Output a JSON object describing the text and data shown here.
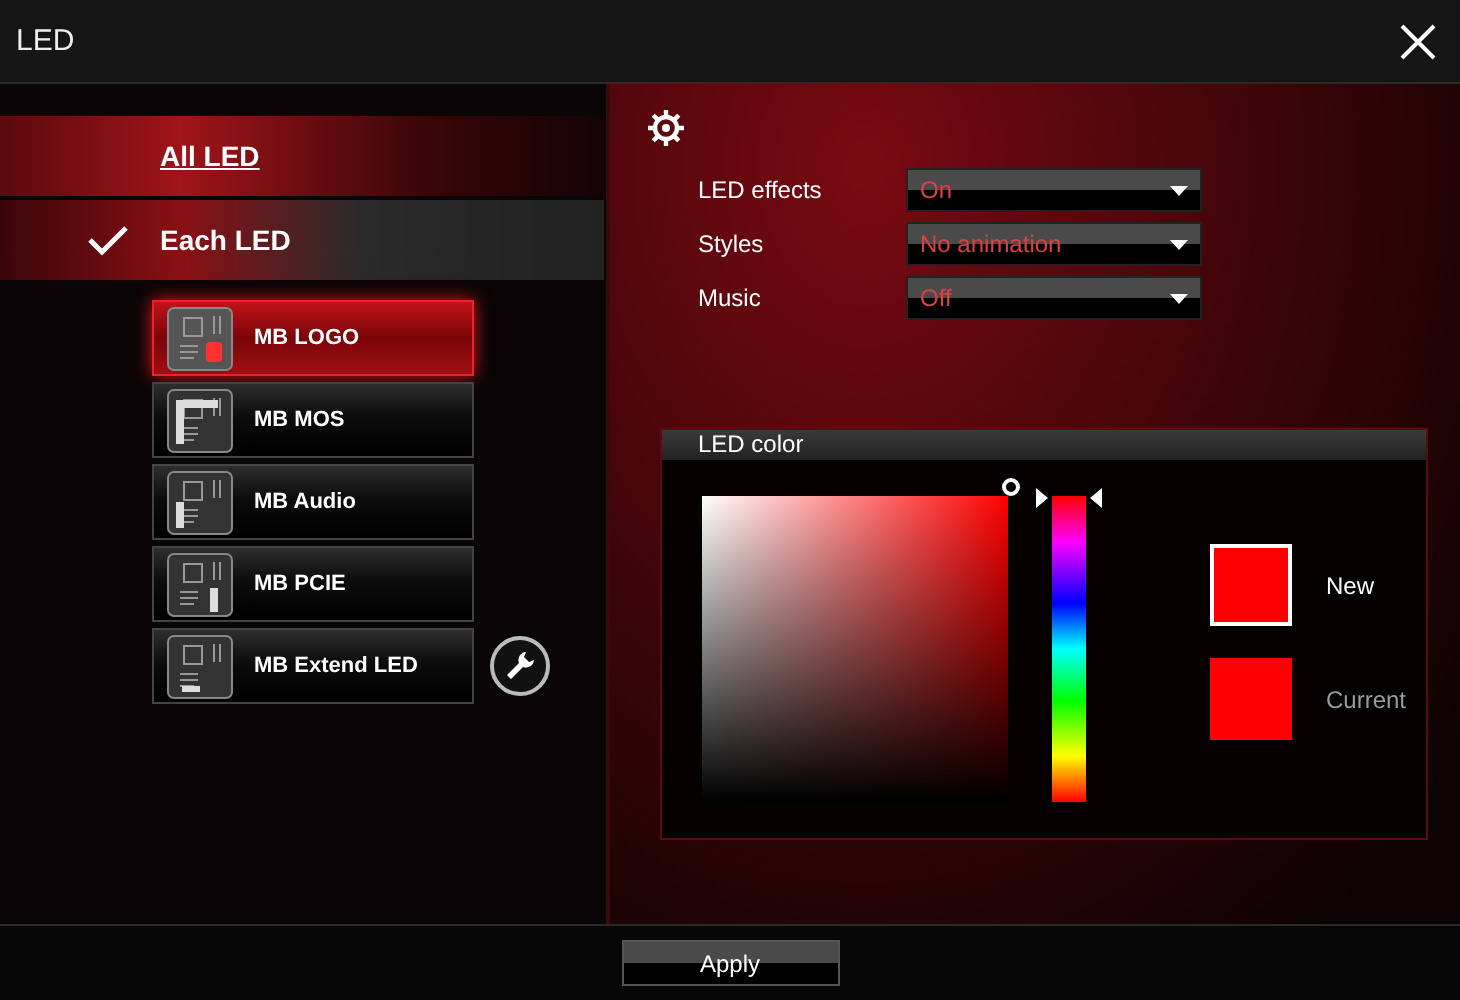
{
  "window": {
    "title": "LED"
  },
  "modes": [
    {
      "label": "All LED",
      "selected": false
    },
    {
      "label": "Each LED",
      "selected": true
    }
  ],
  "devices": [
    {
      "label": "MB LOGO",
      "selected": true,
      "kind": "logo"
    },
    {
      "label": "MB MOS",
      "selected": false,
      "kind": "mos"
    },
    {
      "label": "MB Audio",
      "selected": false,
      "kind": "audio"
    },
    {
      "label": "MB PCIE",
      "selected": false,
      "kind": "pcie"
    },
    {
      "label": "MB Extend LED",
      "selected": false,
      "kind": "extend",
      "has_settings": true
    }
  ],
  "settings": [
    {
      "label": "LED effects",
      "value": "On"
    },
    {
      "label": "Styles",
      "value": "No animation"
    },
    {
      "label": "Music",
      "value": "Off"
    }
  ],
  "led_color": {
    "title": "LED color",
    "hue": {
      "level": 1
    },
    "swatches": [
      {
        "label": "New",
        "color": "#ff0000",
        "selected": true
      },
      {
        "label": "Current",
        "color": "#ff0000",
        "selected": false
      }
    ]
  },
  "apply_button": "Apply"
}
